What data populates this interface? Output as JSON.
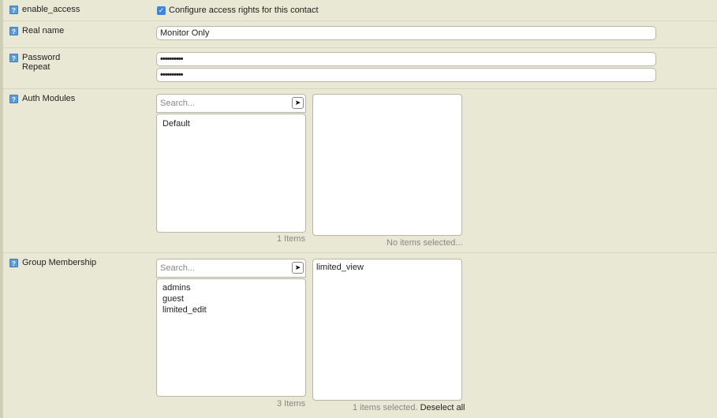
{
  "rows": {
    "enable_access": {
      "label": "enable_access",
      "checkbox_label": "Configure access rights for this contact"
    },
    "real_name": {
      "label": "Real name",
      "value": "Monitor Only"
    },
    "password": {
      "label": "Password",
      "label2": "Repeat",
      "value": "••••••••••",
      "repeat_value": "••••••••••"
    },
    "auth_modules": {
      "label": "Auth Modules",
      "search_placeholder": "Search...",
      "available": [
        "Default"
      ],
      "available_count": "1 Items",
      "selected_status": "No items selected..."
    },
    "group_membership": {
      "label": "Group Membership",
      "search_placeholder": "Search...",
      "available": [
        "admins",
        "guest",
        "limited_edit"
      ],
      "available_count": "3 Items",
      "selected": [
        "limited_view"
      ],
      "selected_status": "1 items selected.",
      "deselect_label": "Deselect all"
    }
  },
  "icons": {
    "help": "help-icon",
    "search_go": "arrow-right-icon",
    "check": "checkmark-icon"
  },
  "colors": {
    "background": "#e9e8d4",
    "help_icon": "#5b9bd8",
    "checkbox": "#3b86de"
  }
}
